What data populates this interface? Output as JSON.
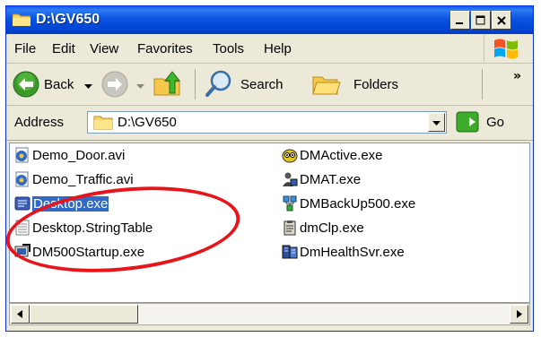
{
  "window": {
    "title": "D:\\GV650",
    "controls": {
      "minimize": "minimize",
      "maximize": "maximize",
      "close": "close"
    }
  },
  "menubar": {
    "items": [
      {
        "label": "File",
        "accel": "F"
      },
      {
        "label": "Edit",
        "accel": "E"
      },
      {
        "label": "View",
        "accel": "V"
      },
      {
        "label": "Favorites",
        "accel": "a"
      },
      {
        "label": "Tools",
        "accel": "T"
      },
      {
        "label": "Help",
        "accel": "H"
      }
    ]
  },
  "toolbar": {
    "back_label": "Back",
    "search_label": "Search",
    "folders_label": "Folders",
    "chevron": "»"
  },
  "address": {
    "label": "Address",
    "value": "D:\\GV650",
    "go_label": "Go"
  },
  "files": {
    "col1": [
      {
        "name": "Demo_Door.avi",
        "icon": "media-file-icon"
      },
      {
        "name": "Demo_Traffic.avi",
        "icon": "media-file-icon"
      },
      {
        "name": "Desktop.exe",
        "icon": "app-exe-icon",
        "selected": true
      },
      {
        "name": "Desktop.StringTable",
        "icon": "table-file-icon"
      },
      {
        "name": "DM500Startup.exe",
        "icon": "startup-exe-icon"
      }
    ],
    "col2": [
      {
        "name": "DMActive.exe",
        "icon": "owl-exe-icon"
      },
      {
        "name": "DMAT.exe",
        "icon": "user-exe-icon"
      },
      {
        "name": "DMBackUp500.exe",
        "icon": "network-exe-icon"
      },
      {
        "name": "dmClp.exe",
        "icon": "clipboard-exe-icon"
      },
      {
        "name": "DmHealthSvr.exe",
        "icon": "server-exe-icon"
      }
    ]
  },
  "annotation": {
    "color": "#e8141b"
  },
  "colors": {
    "titlebar": "#0a54e0",
    "selection": "#316ac5",
    "chrome": "#ece9d8"
  }
}
